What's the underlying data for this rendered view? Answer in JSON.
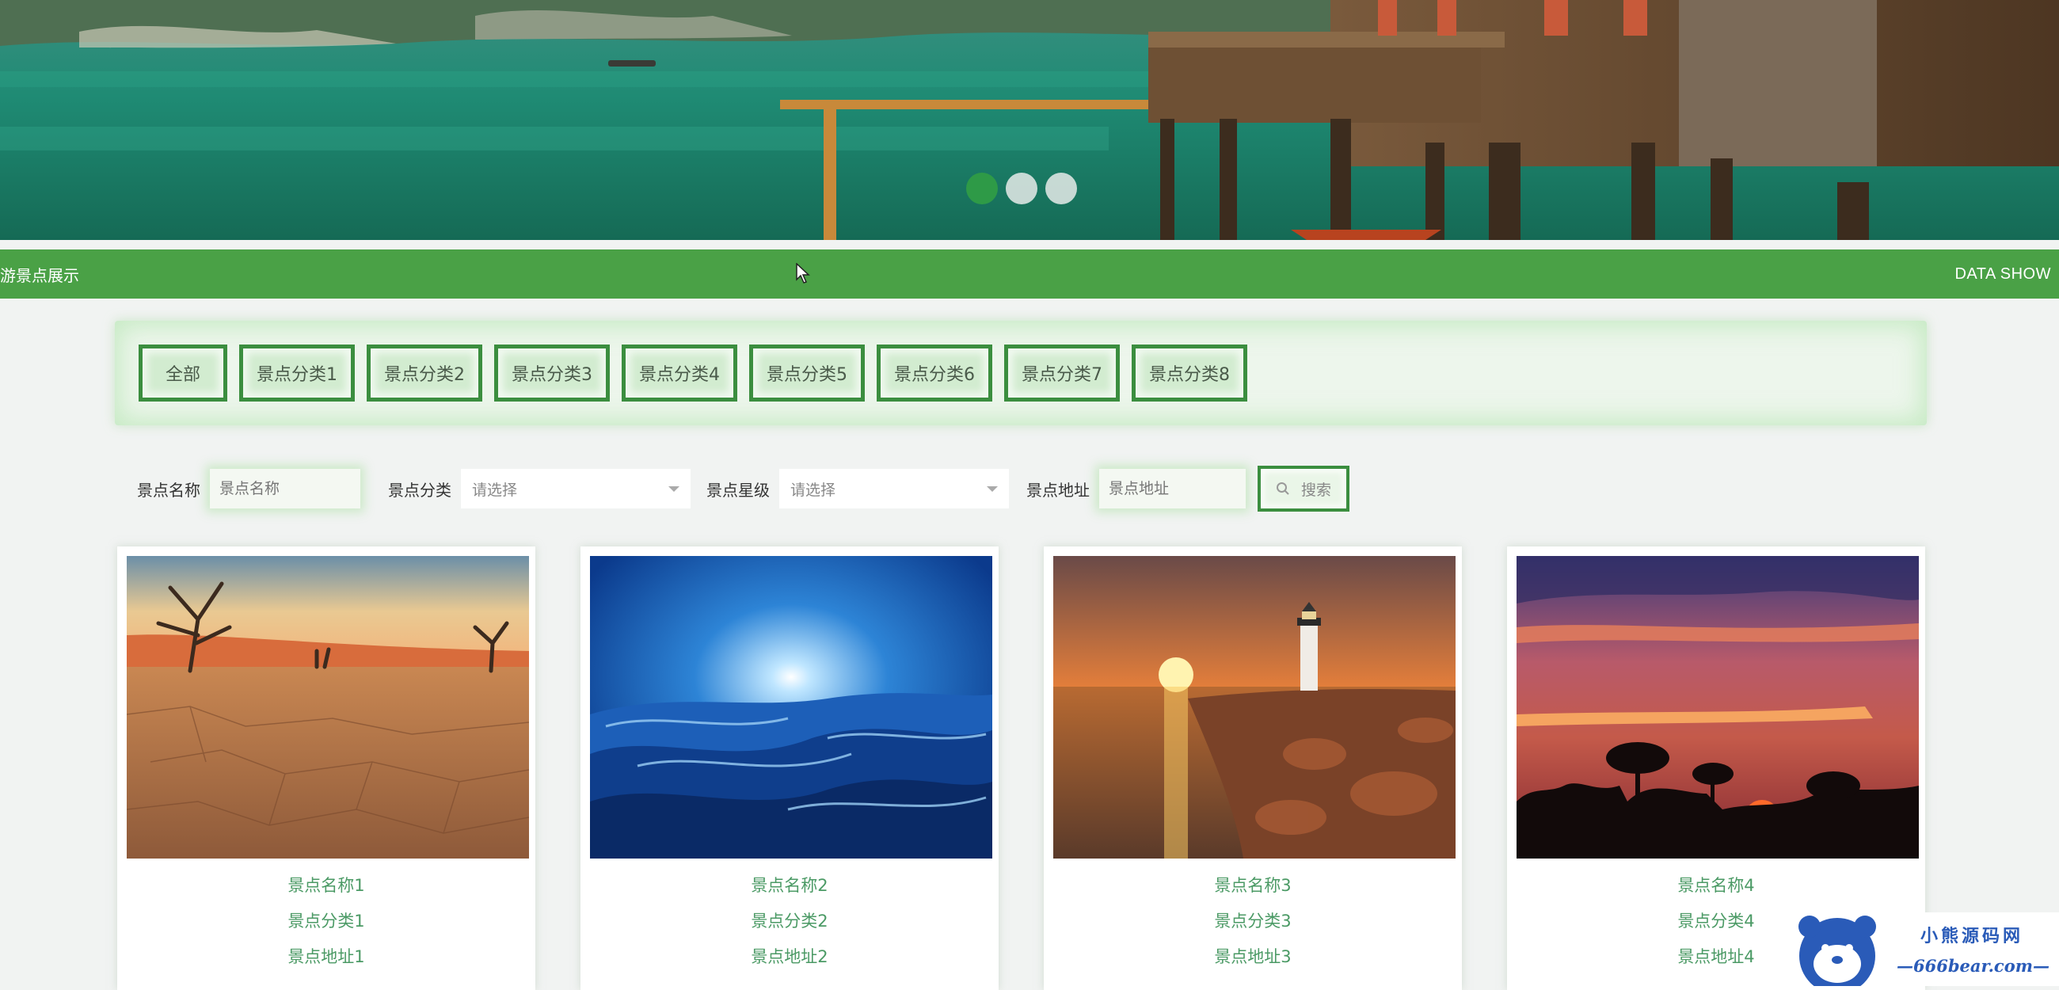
{
  "banner": {
    "slides": 3,
    "active_slide": 1,
    "colors": {
      "active_dot": "#2e9a47",
      "inactive_dot": "#e6ebe9"
    }
  },
  "titlebar": {
    "left_text": "游景点展示",
    "right_text": "DATA SHOW",
    "color": "#4aa146"
  },
  "categories": {
    "all_label": "全部",
    "items": [
      "景点分类1",
      "景点分类2",
      "景点分类3",
      "景点分类4",
      "景点分类5",
      "景点分类6",
      "景点分类7",
      "景点分类8"
    ]
  },
  "search": {
    "name_label": "景点名称",
    "name_placeholder": "景点名称",
    "category_label": "景点分类",
    "category_value": "请选择",
    "level_label": "景点星级",
    "level_value": "请选择",
    "address_label": "景点地址",
    "address_placeholder": "景点地址",
    "button_label": "搜索"
  },
  "spots": [
    {
      "name": "景点名称1",
      "category": "景点分类1",
      "address": "景点地址1",
      "image": "desert-sunset"
    },
    {
      "name": "景点名称2",
      "category": "景点分类2",
      "address": "景点地址2",
      "image": "blue-sun-landscape"
    },
    {
      "name": "景点名称3",
      "category": "景点分类3",
      "address": "景点地址3",
      "image": "lighthouse-sunset"
    },
    {
      "name": "景点名称4",
      "category": "景点分类4",
      "address": "景点地址4",
      "image": "purple-sunset-trees"
    }
  ],
  "watermark": {
    "title": "小熊源码网",
    "url": "—666bear.com—"
  }
}
